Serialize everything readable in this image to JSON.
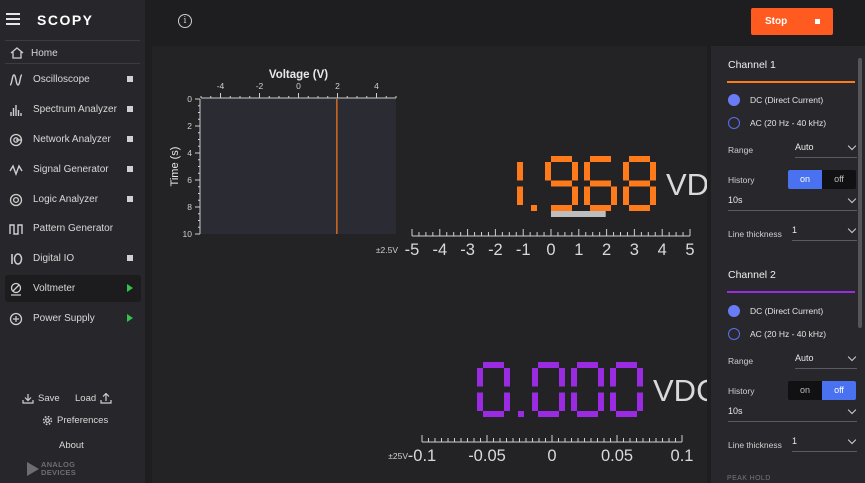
{
  "app": {
    "name": "SCOPY"
  },
  "sidebar": {
    "home_label": "Home",
    "tools": [
      {
        "label": "Oscilloscope",
        "icon": "oscilloscope-icon",
        "indicator": "stopped"
      },
      {
        "label": "Spectrum Analyzer",
        "icon": "spectrum-analyzer-icon",
        "indicator": "stopped"
      },
      {
        "label": "Network Analyzer",
        "icon": "network-analyzer-icon",
        "indicator": "stopped"
      },
      {
        "label": "Signal Generator",
        "icon": "signal-generator-icon",
        "indicator": "stopped"
      },
      {
        "label": "Logic Analyzer",
        "icon": "logic-analyzer-icon",
        "indicator": "stopped"
      },
      {
        "label": "Pattern Generator",
        "icon": "pattern-generator-icon",
        "indicator": "none"
      },
      {
        "label": "Digital IO",
        "icon": "digital-io-icon",
        "indicator": "stopped"
      },
      {
        "label": "Voltmeter",
        "icon": "voltmeter-icon",
        "indicator": "running",
        "active": true
      },
      {
        "label": "Power Supply",
        "icon": "power-supply-icon",
        "indicator": "running"
      }
    ],
    "save_label": "Save",
    "load_label": "Load",
    "preferences_label": "Preferences",
    "about_label": "About",
    "brand_line1": "ANALOG",
    "brand_line2": "DEVICES"
  },
  "toolbar": {
    "stop_label": "Stop"
  },
  "colors": {
    "accent": "#ff5a1f",
    "channel1": "#ff7a1a",
    "channel2": "#9a2be2",
    "toggle_on": "#4a72f0",
    "radio": "#6a7cf5",
    "running": "#34c34a"
  },
  "history_plot": {
    "title": "Voltage (V)",
    "ylabel": "Time (s)",
    "x_ticks": [
      "-4",
      "-2",
      "0",
      "2",
      "4"
    ],
    "y_ticks": [
      "0",
      "2",
      "4",
      "6",
      "8",
      "10"
    ],
    "x_range": [
      -5,
      5
    ],
    "y_range": [
      0,
      10
    ],
    "trace_value": 1.968
  },
  "channel1": {
    "reading": "1.968",
    "unit": "VDC",
    "scale_label": "±2.5V",
    "scale_ticks": [
      "-5",
      "-4",
      "-3",
      "-2",
      "-1",
      "0",
      "1",
      "2",
      "3",
      "4",
      "5"
    ],
    "scale_range": [
      -5,
      5
    ],
    "bar_value": 1.968
  },
  "channel2": {
    "reading": "0.000",
    "unit": "VDC",
    "scale_label": "±25V",
    "scale_ticks": [
      "-0.1",
      "-0.05",
      "0",
      "0.05",
      "0.1"
    ],
    "scale_range": [
      -0.1,
      0.1
    ],
    "bar_value": 0.0
  },
  "panel": {
    "ch1": {
      "title": "Channel 1",
      "dc_label": "DC (Direct Current)",
      "ac_label": "AC (20 Hz - 40 kHz)",
      "mode": "DC",
      "range_label": "Range",
      "range_value": "Auto",
      "history_label": "History",
      "history_on": "on",
      "history_off": "off",
      "history_state": "on",
      "history_duration": "10s",
      "line_thickness_label": "Line thickness",
      "line_thickness_value": "1"
    },
    "ch2": {
      "title": "Channel 2",
      "dc_label": "DC (Direct Current)",
      "ac_label": "AC (20 Hz - 40 kHz)",
      "mode": "DC",
      "range_label": "Range",
      "range_value": "Auto",
      "history_label": "History",
      "history_on": "on",
      "history_off": "off",
      "history_state": "off",
      "history_duration": "10s",
      "line_thickness_label": "Line thickness",
      "line_thickness_value": "1"
    },
    "peak_hold_label": "PEAK HOLD"
  }
}
